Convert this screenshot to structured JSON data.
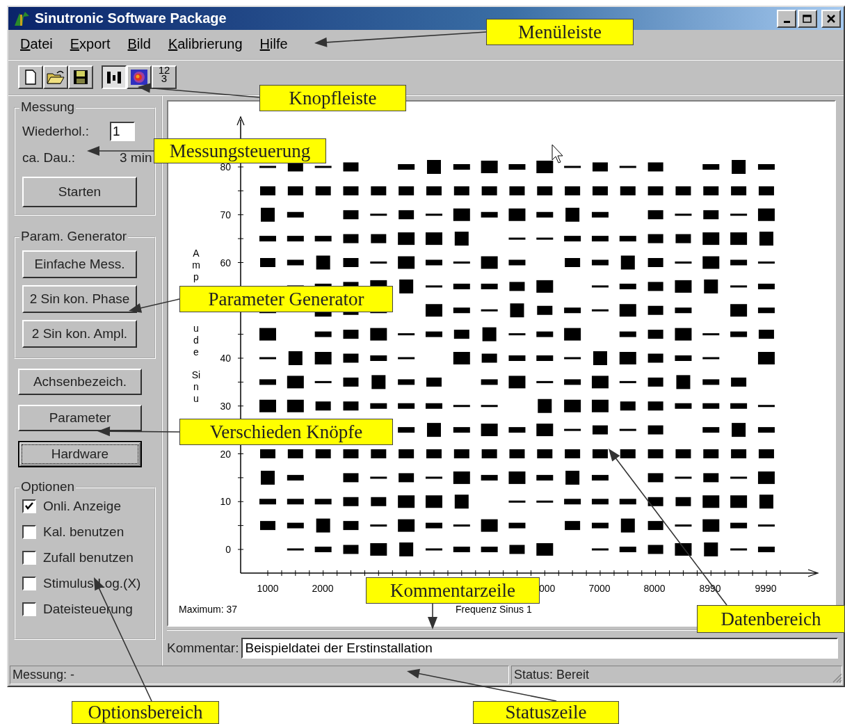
{
  "window": {
    "title": "Sinutronic Software Package"
  },
  "menu": [
    {
      "label": "Datei"
    },
    {
      "label": "Export"
    },
    {
      "label": "Bild"
    },
    {
      "label": "Kalibrierung"
    },
    {
      "label": "Hilfe"
    }
  ],
  "toolbar": [
    {
      "kind": "new",
      "pressed": false
    },
    {
      "kind": "open",
      "pressed": false
    },
    {
      "kind": "save",
      "pressed": false
    },
    {
      "kind": "bars",
      "pressed": true
    },
    {
      "kind": "colormap",
      "pressed": false
    },
    {
      "kind": "numbers",
      "pressed": false,
      "lines": [
        "12",
        "3"
      ]
    }
  ],
  "measurement": {
    "title": "Messung",
    "repeat_label": "Wiederhol.:",
    "repeat_value": "1",
    "duration_label": "ca. Dau.:",
    "duration_value": "3 min",
    "start_button": "Starten"
  },
  "generator": {
    "title": "Param. Generator",
    "buttons": [
      "Einfache Mess.",
      "2 Sin kon. Phase",
      "2 Sin kon. Ampl."
    ]
  },
  "buttons": [
    {
      "label": "Achsenbezeich.",
      "focused": false
    },
    {
      "label": "Parameter",
      "focused": false
    },
    {
      "label": "Hardware",
      "focused": true
    }
  ],
  "options": {
    "title": "Optionen",
    "items": [
      {
        "label": "Onli. Anzeige",
        "checked": true
      },
      {
        "label": "Kal. benutzen",
        "checked": false
      },
      {
        "label": "Zufall benutzen",
        "checked": false
      },
      {
        "label": "Stimulus Log.(X)",
        "checked": false
      },
      {
        "label": "Dateisteuerung",
        "checked": false
      }
    ]
  },
  "plot": {
    "ylabel": [
      "Amp",
      "ude",
      "Sinu"
    ],
    "yticks": [
      "80",
      "70",
      "60",
      "40",
      "30",
      "20",
      "10",
      "0"
    ],
    "xticks": [
      "1000",
      "2000",
      "000",
      "7000",
      "8000",
      "8990",
      "9990"
    ],
    "maximum": "Maximum: 37",
    "xlabel": "Frequenz Sinus 1"
  },
  "comment": {
    "label": "Kommentar:",
    "value": "Beispieldatei der Erstinstallation"
  },
  "status_bar": [
    "Messung: -",
    "Status: Bereit"
  ],
  "callouts": [
    "Menüleiste",
    "Knopfleiste",
    "Messungsteuerung",
    "Parameter Generator",
    "Verschieden Knöpfe",
    "Kommentarzeile",
    "Datenbereich",
    "Optionsbereich",
    "Statuszeile"
  ]
}
